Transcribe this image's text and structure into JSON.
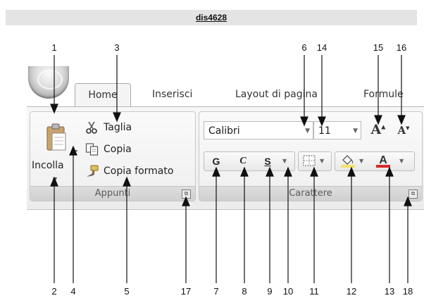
{
  "page": {
    "title": "dis4628"
  },
  "ribbon": {
    "tabs": [
      "Home",
      "Inserisci",
      "Layout di pagina",
      "Formule"
    ],
    "clipboard_group": {
      "label": "Appunti",
      "paste_label": "Incolla",
      "cut_label": "Taglia",
      "copy_label": "Copia",
      "format_painter_label": "Copia formato",
      "launcher": "⧉"
    },
    "font_group": {
      "label": "Carattere",
      "font_name": "Calibri",
      "font_size": "11",
      "bold": "G",
      "italic": "C",
      "underline": "S",
      "grow_font": "A",
      "shrink_font": "A",
      "launcher": "⧉"
    }
  },
  "callouts": {
    "top": [
      "1",
      "3",
      "6",
      "14",
      "15",
      "16"
    ],
    "bottom": [
      "2",
      "4",
      "5",
      "17",
      "7",
      "8",
      "9",
      "10",
      "11",
      "12",
      "13",
      "18"
    ]
  },
  "colors": {
    "font_color_bar": "#d62b2b",
    "highlight_bar": "#f2e36b",
    "pointer": "#111111"
  },
  "icons": [
    "office-orb-icon",
    "paste-clipboard-icon",
    "scissors-icon",
    "copy-icon",
    "format-painter-icon",
    "borders-icon",
    "fill-bucket-icon",
    "font-color-icon",
    "dialog-launcher-icon",
    "dropdown-arrow-icon"
  ]
}
